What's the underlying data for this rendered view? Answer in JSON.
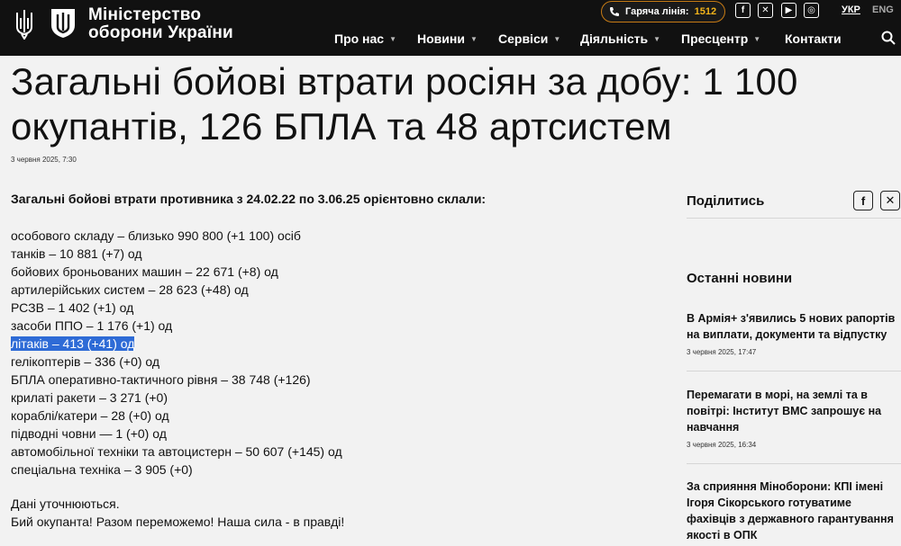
{
  "header": {
    "brand_line1": "Міністерство",
    "brand_line2": "оборони України",
    "hotline_label": "Гаряча лінія:",
    "hotline_number": "1512",
    "lang_active": "УКР",
    "lang_other": "ENG",
    "nav": [
      {
        "label": "Про нас"
      },
      {
        "label": "Новини"
      },
      {
        "label": "Сервіси"
      },
      {
        "label": "Діяльність"
      },
      {
        "label": "Пресцентр"
      },
      {
        "label": "Контакти"
      }
    ],
    "colors": {
      "bg": "#111111",
      "accent": "#f2b31a"
    }
  },
  "article": {
    "title": "Загальні бойові втрати росіян за добу: 1 100 окупантів, 126 БПЛА та 48 артсистем",
    "date": "3 червня 2025, 7:30",
    "lead": "Загальні бойові втрати противника з 24.02.22 по 3.06.25 орієнтовно склали:",
    "items": [
      "особового складу ‒ близько 990 800 (+1 100) осіб",
      "танків ‒ 10 881 (+7) од",
      "бойових броньованих машин ‒ 22 671 (+8) од",
      "артилерійських систем – 28 623 (+48) од",
      "РСЗВ – 1 402 (+1) од",
      "засоби ППО ‒ 1 176 (+1) од",
      "літаків – 413 (+41) од",
      "гелікоптерів – 336 (+0) од",
      "БПЛА оперативно-тактичного рівня – 38 748 (+126)",
      "крилаті ракети ‒ 3 271 (+0)",
      "кораблі/катери ‒ 28 (+0) од",
      "підводні човни — 1 (+0) од",
      "автомобільної техніки та автоцистерн – 50 607 (+145) од",
      "спеціальна техніка ‒  3 905 (+0)"
    ],
    "footer_line1": "Дані уточнюються.",
    "footer_line2": "Бий окупанта! Разом переможемо! Наша сила - в правді!"
  },
  "sidebar": {
    "share_title": "Поділитись",
    "news_title": "Останні новини",
    "news": [
      {
        "title": "В Армія+ з'явились 5 нових рапортів на виплати, документи та відпустку",
        "date": "3 червня 2025, 17:47"
      },
      {
        "title": "Перемагати в морі, на землі та в повітрі: Інститут ВМС запрошує на навчання",
        "date": "3 червня 2025, 16:34"
      },
      {
        "title": "За сприяння Міноборони: КПІ імені Ігоря Сікорського готуватиме фахівців з державного гарантування якості в ОПК",
        "date": ""
      }
    ]
  }
}
